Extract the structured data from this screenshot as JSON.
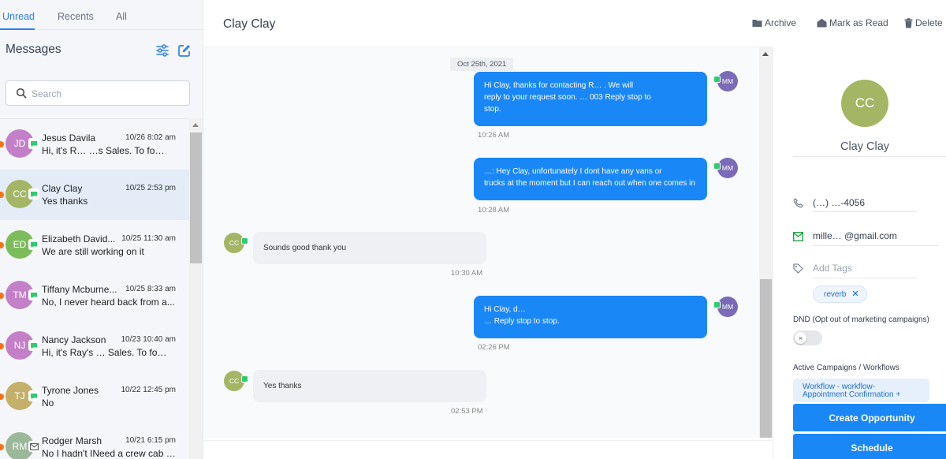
{
  "tabs": [
    {
      "label": "Unread",
      "active": true
    },
    {
      "label": "Recents",
      "active": false
    },
    {
      "label": "All",
      "active": false
    }
  ],
  "sidebar": {
    "title": "Messages",
    "search_placeholder": "Search"
  },
  "conversations": [
    {
      "initials": "JD",
      "name": "Jesus Davila",
      "date": "10/26 8:02 am",
      "preview": "Hi, it's R… …s Sales. To fo…",
      "avatar_color": "#c37fc8",
      "channel": "sms",
      "selected": false
    },
    {
      "initials": "CC",
      "name": "Clay Clay",
      "date": "10/25 2:53 pm",
      "preview": "Yes thanks",
      "avatar_color": "#a4b664",
      "channel": "sms",
      "selected": true
    },
    {
      "initials": "ED",
      "name": "Elizabeth David...",
      "date": "10/25 11:30 am",
      "preview": "We are still working on it",
      "avatar_color": "#7dbc5a",
      "channel": "sms",
      "selected": false
    },
    {
      "initials": "TM",
      "name": "Tiffany Mcburne...",
      "date": "10/25 8:33 am",
      "preview": "No, I never heard back from a...",
      "avatar_color": "#c37fc8",
      "channel": "sms",
      "selected": false
    },
    {
      "initials": "NJ",
      "name": "Nancy Jackson",
      "date": "10/23 10:40 am",
      "preview": "Hi, it's Ray's … Sales. To fo…",
      "avatar_color": "#c37fc8",
      "channel": "sms",
      "selected": false
    },
    {
      "initials": "TJ",
      "name": "Tyrone Jones",
      "date": "10/22 12:45 pm",
      "preview": "No",
      "avatar_color": "#c4b06a",
      "channel": "sms",
      "selected": false
    },
    {
      "initials": "RM",
      "name": "Rodger Marsh",
      "date": "10/21 6:15 pm",
      "preview": "No I hadn't INeed a crew cab …",
      "avatar_color": "#9cb89a",
      "channel": "email",
      "selected": false
    }
  ],
  "chat": {
    "title": "Clay Clay",
    "actions": {
      "archive": "Archive",
      "mark_read": "Mark as Read",
      "delete": "Delete"
    },
    "date_divider": "Oct 25th, 2021",
    "messages": [
      {
        "direction": "out",
        "avatar": "MM",
        "lines": [
          "Hi Clay, thanks for contacting R… . We will",
          "reply to your request soon. … 003 Reply stop to",
          "stop."
        ],
        "time": "10:26 AM"
      },
      {
        "direction": "out",
        "avatar": "MM",
        "lines": [
          "…: Hey Clay, unfortunately I dont have any vans or",
          "trucks at the moment but I can reach out when one comes in"
        ],
        "time": "10:28 AM"
      },
      {
        "direction": "in",
        "avatar": "CC",
        "lines": [
          "Sounds good thank you"
        ],
        "time": "10:30 AM"
      },
      {
        "direction": "out",
        "avatar": "MM",
        "lines": [
          "Hi Clay, d… ",
          "… Reply stop to stop."
        ],
        "time": "02:26 PM"
      },
      {
        "direction": "in",
        "avatar": "CC",
        "lines": [
          "Yes thanks"
        ],
        "time": "02:53 PM"
      }
    ]
  },
  "contact": {
    "initials": "CC",
    "name": "Clay Clay",
    "phone": "(…) …-4056",
    "email": "mille… @gmail.com",
    "tags_placeholder": "Add Tags",
    "tags": [
      "reverb"
    ],
    "dnd_label": "DND (Opt out of marketing campaigns)",
    "dnd_enabled": false,
    "campaigns_label": "Active Campaigns / Workflows",
    "campaign": "Workflow - workflow- Appointment Confirmation +",
    "buttons": {
      "create_opportunity": "Create Opportunity",
      "schedule": "Schedule"
    }
  },
  "colors": {
    "accent": "#1a87f6",
    "outgoing_bubble": "#1a87f6",
    "incoming_bubble": "#eef0f4",
    "unread_dot": "#f97316",
    "channel_badge": "#2ecc71"
  }
}
